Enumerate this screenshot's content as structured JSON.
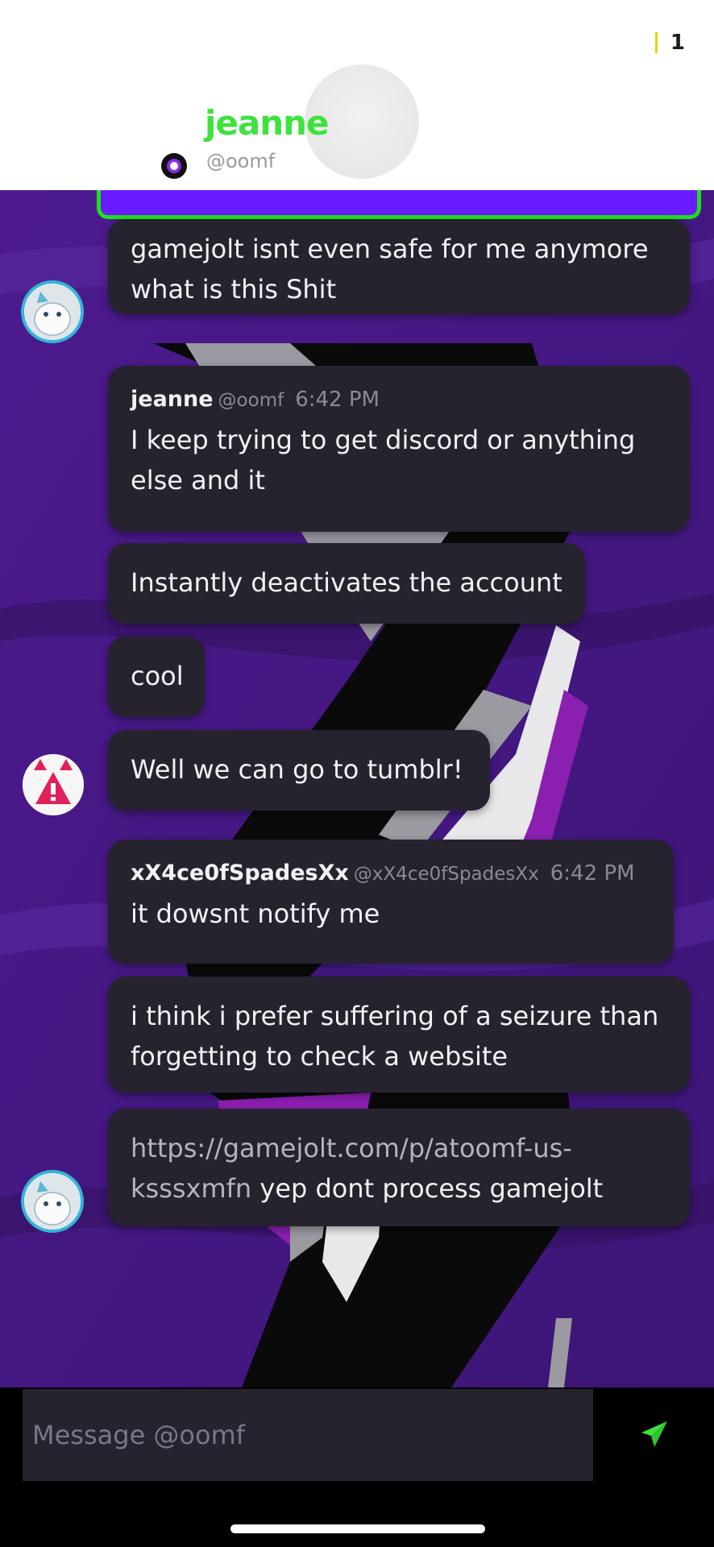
{
  "header": {
    "notification_count": "1",
    "name": "jeanne",
    "handle": "@oomf"
  },
  "messages": [
    {
      "text": "gamejolt isnt even safe for me anymore what is this Shit"
    },
    {
      "author": "jeanne",
      "handle": "@oomf",
      "time": "6:42 PM",
      "text": "I keep trying to get discord or anything else and it"
    },
    {
      "text": "Instantly deactivates the account"
    },
    {
      "text": "cool"
    },
    {
      "text": "Well we can go to tumblr!"
    },
    {
      "author": "xX4ce0fSpadesXx",
      "handle": "@xX4ce0fSpadesXx",
      "time": "6:42 PM",
      "text": "it dowsnt notify me"
    },
    {
      "text": "i think i prefer suffering of a seizure than forgetting to check a website"
    },
    {
      "link": "https://gamejolt.com/p/atoomf-us-ksssxmfn",
      "text": " yep dont process gamejolt"
    }
  ],
  "composer": {
    "placeholder": "Message @oomf"
  },
  "colors": {
    "accent_green": "#3ee23c",
    "bubble_bg": "#26232e",
    "chat_bg": "#4a1c8a"
  },
  "icons": [
    "notification-bar-icon",
    "profile-ring-icon",
    "send-icon"
  ]
}
